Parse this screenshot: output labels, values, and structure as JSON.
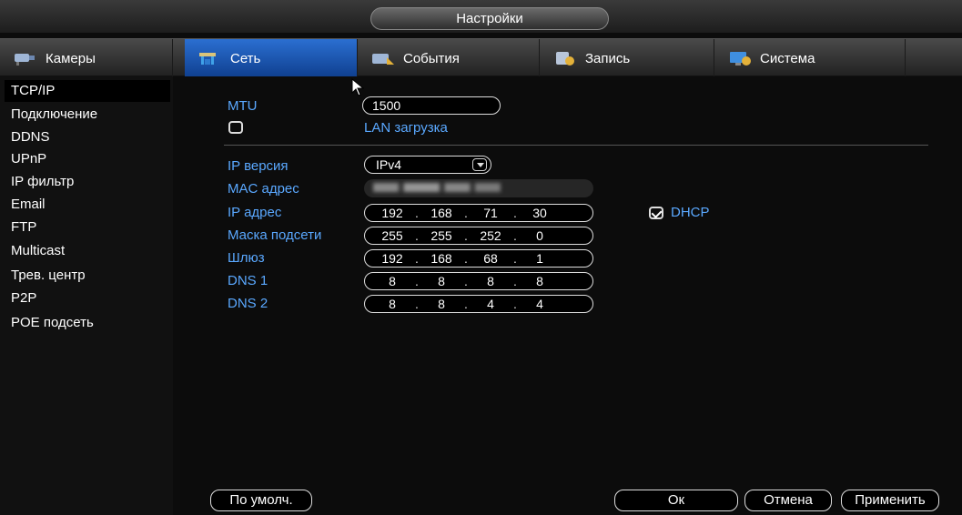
{
  "window": {
    "title": "Настройки"
  },
  "tabs": [
    {
      "label": "Камеры",
      "icon": "cameras-icon",
      "active": false
    },
    {
      "label": "Сеть",
      "icon": "network-icon",
      "active": true
    },
    {
      "label": "События",
      "icon": "events-icon",
      "active": false
    },
    {
      "label": "Запись",
      "icon": "record-icon",
      "active": false
    },
    {
      "label": "Система",
      "icon": "system-icon",
      "active": false
    }
  ],
  "sidebar": {
    "items": [
      {
        "label": "TCP/IP",
        "active": true
      },
      {
        "label": "Подключение",
        "active": false
      },
      {
        "label": "DDNS",
        "active": false
      },
      {
        "label": "UPnP",
        "active": false
      },
      {
        "label": "IP фильтр",
        "active": false
      },
      {
        "label": "Email",
        "active": false
      },
      {
        "label": "FTP",
        "active": false
      },
      {
        "label": "Multicast",
        "active": false
      },
      {
        "label": "Трев. центр",
        "active": false
      },
      {
        "label": "P2P",
        "active": false
      },
      {
        "label": "POE подсеть",
        "active": false
      }
    ]
  },
  "form": {
    "mtu": {
      "label": "MTU",
      "value": "1500"
    },
    "lan_download": {
      "label": "LAN загрузка",
      "checked": false
    },
    "ip_version": {
      "label": "IP версия",
      "value": "IPv4"
    },
    "mac": {
      "label": "MAC адрес"
    },
    "ip": {
      "label": "IP адрес",
      "octets": [
        "192",
        "168",
        "71",
        "30"
      ]
    },
    "dhcp": {
      "label": "DHCP",
      "checked": true
    },
    "mask": {
      "label": "Маска подсети",
      "octets": [
        "255",
        "255",
        "252",
        "0"
      ]
    },
    "gateway": {
      "label": "Шлюз",
      "octets": [
        "192",
        "168",
        "68",
        "1"
      ]
    },
    "dns1": {
      "label": "DNS 1",
      "octets": [
        "8",
        "8",
        "8",
        "8"
      ]
    },
    "dns2": {
      "label": "DNS 2",
      "octets": [
        "8",
        "8",
        "4",
        "4"
      ]
    }
  },
  "buttons": {
    "default": "По умолч.",
    "ok": "Ок",
    "cancel": "Отмена",
    "apply": "Применить"
  },
  "colors": {
    "accent": "#1d5bbf",
    "label_blue": "#5aa8ff"
  }
}
